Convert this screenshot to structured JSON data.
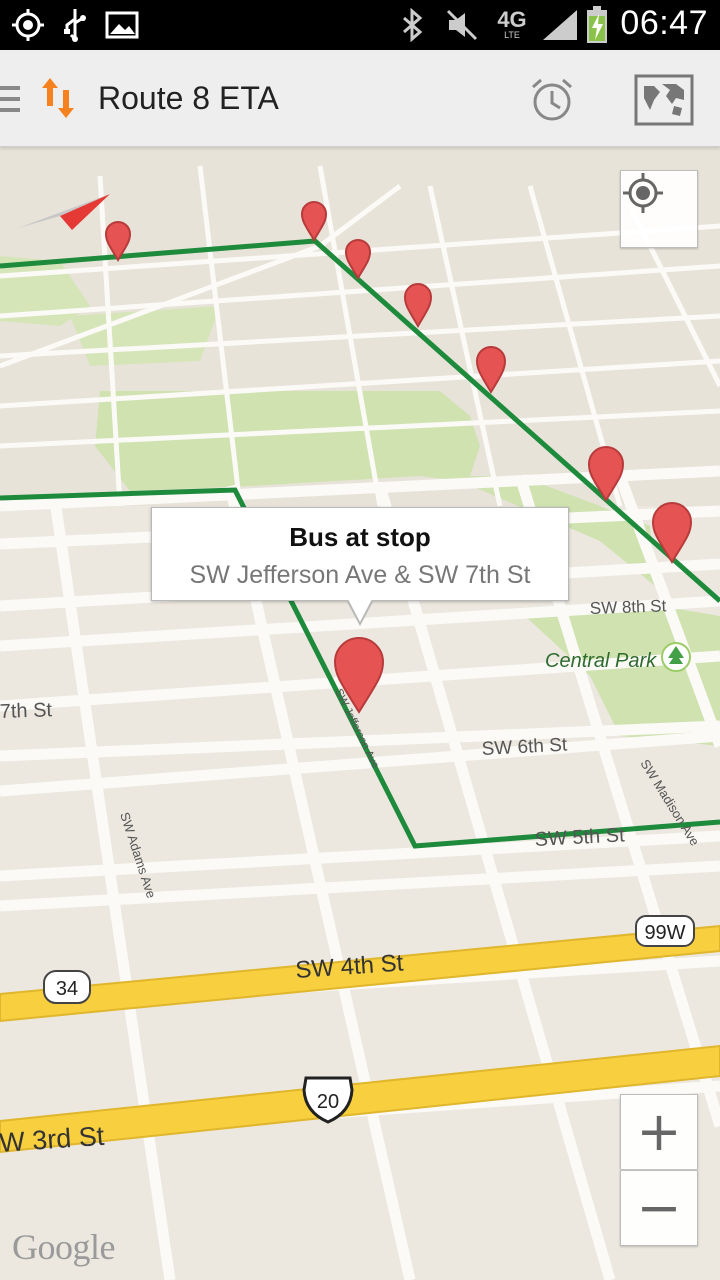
{
  "status_bar": {
    "time": "06:47",
    "network": "4G",
    "network_sub": "LTE",
    "icons": [
      "gps-icon",
      "usb-icon",
      "gallery-icon",
      "bluetooth-icon",
      "mute-icon",
      "network-4g-icon",
      "signal-icon",
      "battery-charging-icon"
    ]
  },
  "action_bar": {
    "title": "Route 8 ETA",
    "icons": [
      "menu-icon",
      "app-logo-icon",
      "alarm-icon",
      "map-view-icon"
    ]
  },
  "map": {
    "streets": {
      "sw_7th": "7th St",
      "sw_8th": "SW 8th St",
      "sw_6th": "SW 6th St",
      "sw_5th": "SW 5th St",
      "sw_4th": "SW 4th St",
      "sw_3rd": "W 3rd St",
      "adams": "SW Adams Ave",
      "madison": "SW Madison Ave",
      "jefferson": "SW Jefferson Ave"
    },
    "park_label": "Central Park",
    "shields": {
      "s34": "34",
      "s20": "20",
      "s99w": "99W"
    },
    "info_window": {
      "title": "Bus at stop",
      "subtitle": "SW Jefferson Ave & SW 7th St"
    },
    "google_logo": "Google",
    "colors": {
      "route": "#1e8a3c",
      "marker": "#e55353",
      "highway": "#f7cf3f",
      "park": "#cfe2b0",
      "land": "#ece8e0"
    }
  },
  "controls": {
    "zoom_in": "+",
    "zoom_out": "−"
  }
}
